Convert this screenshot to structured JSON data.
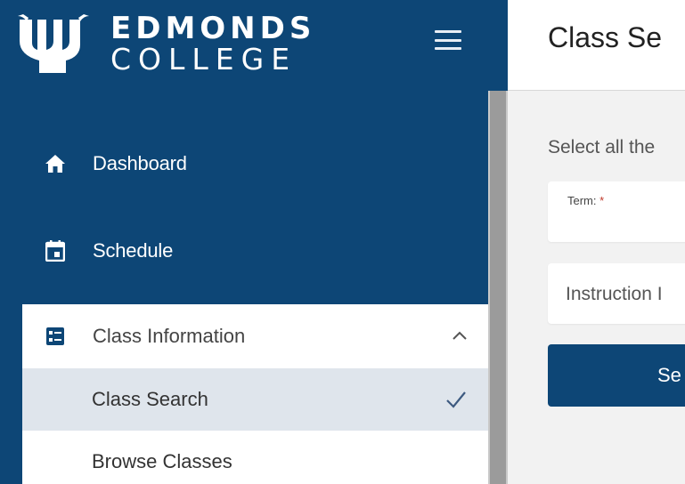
{
  "brand": {
    "name_line1": "EDMONDS",
    "name_line2": "COLLEGE",
    "logo_icon": "trident-logo",
    "color": "#0d4676"
  },
  "header": {
    "menu_icon": "hamburger-menu-icon",
    "page_title": "Class Se"
  },
  "sidebar": {
    "items": [
      {
        "label": "Dashboard",
        "icon": "home-icon"
      },
      {
        "label": "Schedule",
        "icon": "calendar-icon"
      }
    ],
    "class_information": {
      "label": "Class Information",
      "icon": "list-grid-icon",
      "expanded": true,
      "toggle_icon": "chevron-up-icon",
      "children": [
        {
          "label": "Class Search",
          "active": true,
          "icon": "checkmark-icon"
        },
        {
          "label": "Browse Classes",
          "active": false
        }
      ]
    }
  },
  "main": {
    "hint": "Select all the",
    "term_field": {
      "label": "Term:",
      "required_marker": "*"
    },
    "instruction_field": {
      "placeholder": "Instruction I"
    },
    "search_button": {
      "label": "Se"
    }
  },
  "colors": {
    "sidebar_bg": "#0d4676",
    "active_item_bg": "#dfe5ec",
    "required": "#c0392b",
    "content_bg": "#f2f2f2"
  }
}
